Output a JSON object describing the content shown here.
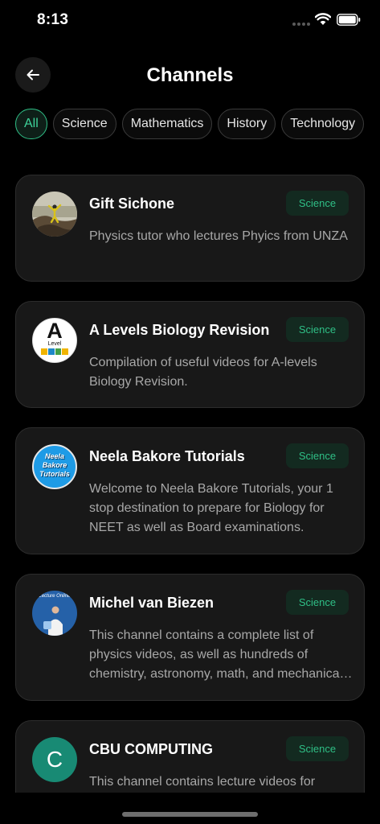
{
  "status_bar": {
    "time": "8:13"
  },
  "header": {
    "title": "Channels"
  },
  "filters": [
    {
      "label": "All",
      "active": true
    },
    {
      "label": "Science",
      "active": false
    },
    {
      "label": "Mathematics",
      "active": false
    },
    {
      "label": "History",
      "active": false
    },
    {
      "label": "Technology",
      "active": false
    }
  ],
  "channels": [
    {
      "name": "Gift Sichone",
      "tag": "Science",
      "description": "Physics tutor who lectures Phyics from UNZA"
    },
    {
      "name": "A Levels Biology Revision",
      "tag": "Science",
      "description": "Compilation of useful videos for A-levels Biology Revision.",
      "avatar_text": "A",
      "avatar_sub": "Level"
    },
    {
      "name": "Neela Bakore Tutorials",
      "tag": "Science",
      "description": "Welcome to Neela Bakore Tutorials, your 1 stop destination to prepare for Biology for NEET as well as Board examinations.",
      "avatar_text": "Neela Bakore Tutorials"
    },
    {
      "name": " Michel van Biezen",
      "tag": "Science",
      "description": "This channel contains a complete list of physics videos, as well as hundreds of chemistry, astronomy,  math, and mechanical engineering videos.",
      "avatar_text": "Lecture Online"
    },
    {
      "name": "CBU COMPUTING",
      "tag": "Science",
      "description": "This channel contains lecture videos for",
      "avatar_text": "C"
    }
  ],
  "colors": {
    "accent": "#2fbf86",
    "background": "#000000",
    "card": "#181818",
    "tag_bg": "#132a20"
  }
}
